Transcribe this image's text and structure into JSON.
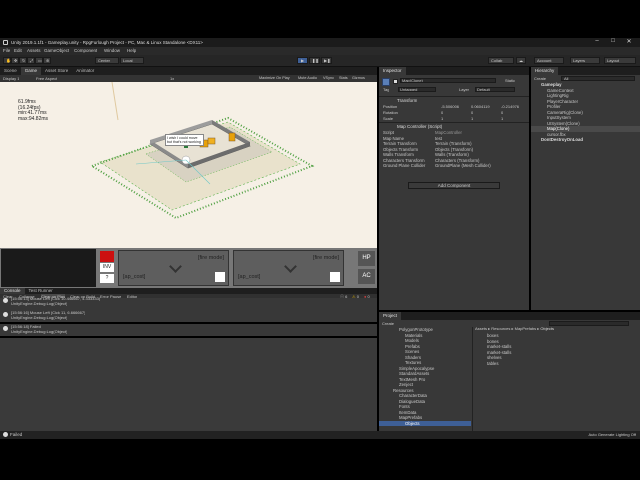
{
  "window": {
    "title": "Unity 2019.1.1f1 - Gameplay.unity - RpgFurlough Project - PC, Mac & Linux Standalone <DX11>",
    "controls": [
      "–",
      "□",
      "✕"
    ]
  },
  "menu": [
    "File",
    "Edit",
    "Assets",
    "GameObject",
    "Component",
    "Window",
    "Help"
  ],
  "toolbar": {
    "pivot": "Center",
    "space": "Local",
    "collab": "Collab",
    "account": "Account",
    "layers": "Layers",
    "layout": "Layout"
  },
  "game_view": {
    "tabs": [
      "Scene",
      "Game",
      "Asset Store",
      "Animator"
    ],
    "display": "Display 1",
    "aspect": "Free Aspect",
    "scale": "1x",
    "options": [
      "Maximize On Play",
      "Mute Audio",
      "VSync",
      "Stats",
      "Gizmos"
    ],
    "stats": [
      "61.9fms",
      "(16.24fps)",
      "min:41.77ms",
      "max:94.82ms"
    ],
    "dialogue": "I wish I could move but that's not working",
    "hud": {
      "inv": "INV",
      "help": "?",
      "slots": [
        {
          "mode": "[fire mode]",
          "cost": "[ap_cost]"
        },
        {
          "mode": "[fire mode]",
          "cost": "[ap_cost]"
        }
      ],
      "hp": "HP",
      "ac": "AC"
    }
  },
  "inspector": {
    "tab": "Inspector",
    "object_name": "Map(Clone)",
    "static": "Static",
    "tag_label": "Tag",
    "tag": "Untagged",
    "layer_label": "Layer",
    "layer": "Default",
    "transform": {
      "title": "Transform",
      "position": {
        "label": "Position",
        "x": "-5.506006",
        "y": "0.0604119",
        "z": "-0.214976"
      },
      "rotation": {
        "label": "Rotation",
        "x": "0",
        "y": "0",
        "z": "0"
      },
      "scale": {
        "label": "Scale",
        "x": "1",
        "y": "1",
        "z": "1"
      }
    },
    "map_controller": {
      "title": "Map Controller (Script)",
      "fields": [
        {
          "label": "Script",
          "value": "MapController"
        },
        {
          "label": "Map Name",
          "value": "test"
        },
        {
          "label": "Terrain Transform",
          "value": "Terrain (Transform)"
        },
        {
          "label": "Objects Transform",
          "value": "Objects (Transform)"
        },
        {
          "label": "Walls Transform",
          "value": "Walls (Transform)"
        },
        {
          "label": "Characters Transform",
          "value": "Characters (Transform)"
        },
        {
          "label": "Ground Plane Collider",
          "value": "GroundPlane (Mesh Collider)"
        }
      ]
    },
    "add_component": "Add Component"
  },
  "hierarchy": {
    "tab": "Hierarchy",
    "create": "Create",
    "search_placeholder": "All",
    "items": [
      {
        "name": "Gameplay",
        "depth": 0
      },
      {
        "name": "GameContext",
        "depth": 1
      },
      {
        "name": "LightingRig",
        "depth": 1
      },
      {
        "name": "PlayerCharacter",
        "depth": 1
      },
      {
        "name": "Profiler",
        "depth": 1
      },
      {
        "name": "CameraRig(Clone)",
        "depth": 1
      },
      {
        "name": "InputSystem",
        "depth": 1
      },
      {
        "name": "UISystem(Clone)",
        "depth": 1
      },
      {
        "name": "Map(Clone)",
        "depth": 1,
        "selected": true
      },
      {
        "name": "cursor.fbx",
        "depth": 1
      },
      {
        "name": "DontDestroyOnLoad",
        "depth": 0
      }
    ]
  },
  "console": {
    "tabs": [
      "Console",
      "Test Runner"
    ],
    "buttons": [
      "Clear",
      "Collapse",
      "Clear on Play",
      "Clear on Build",
      "Error Pause",
      "Editor"
    ],
    "counts": [
      "6",
      "0",
      "0"
    ],
    "entries": [
      {
        "line1": "[15:56:13] Mouse Left (Clck 10.446667, 4.333333)",
        "line2": "UnityEngine.Debug:Log(Object)"
      },
      {
        "line1": "[15:56:16] Mouse Left (Clck 11, 6.666667)",
        "line2": "UnityEngine.Debug:Log(Object)"
      },
      {
        "line1": "[15:56:18] Failed",
        "line2": "UnityEngine.Debug:Log(Object)"
      }
    ]
  },
  "project": {
    "tab": "Project",
    "create": "Create",
    "tree": [
      {
        "name": "PolygonPrototype",
        "depth": 2
      },
      {
        "name": "Materials",
        "depth": 3
      },
      {
        "name": "Models",
        "depth": 3
      },
      {
        "name": "Prefabs",
        "depth": 3
      },
      {
        "name": "Scenes",
        "depth": 3
      },
      {
        "name": "Shaders",
        "depth": 3
      },
      {
        "name": "Textures",
        "depth": 3
      },
      {
        "name": "SimpleApocalypse",
        "depth": 2
      },
      {
        "name": "StandardAssets",
        "depth": 2
      },
      {
        "name": "TextMesh Pro",
        "depth": 2
      },
      {
        "name": "Zenject",
        "depth": 2
      },
      {
        "name": "Resources",
        "depth": 1
      },
      {
        "name": "CharacterData",
        "depth": 2
      },
      {
        "name": "DialogueData",
        "depth": 2
      },
      {
        "name": "Fonts",
        "depth": 2
      },
      {
        "name": "ItemData",
        "depth": 2
      },
      {
        "name": "MapPrefabs",
        "depth": 2
      },
      {
        "name": "Objects",
        "depth": 3,
        "selected": true
      }
    ],
    "breadcrumb": [
      "Assets",
      "Resources",
      "MapPrefabs",
      "Objects"
    ],
    "files": [
      "boxes",
      "bones",
      "market-stalls",
      "market-stalls",
      "shelves",
      "tables"
    ]
  },
  "status": {
    "message": "Failed",
    "right": "Auto Generate Lighting Off"
  },
  "colors": {
    "accent": "#3e5f96",
    "hud_red": "#cc1010",
    "grass": "#5bb24a",
    "fence": "#7d5a2a"
  }
}
